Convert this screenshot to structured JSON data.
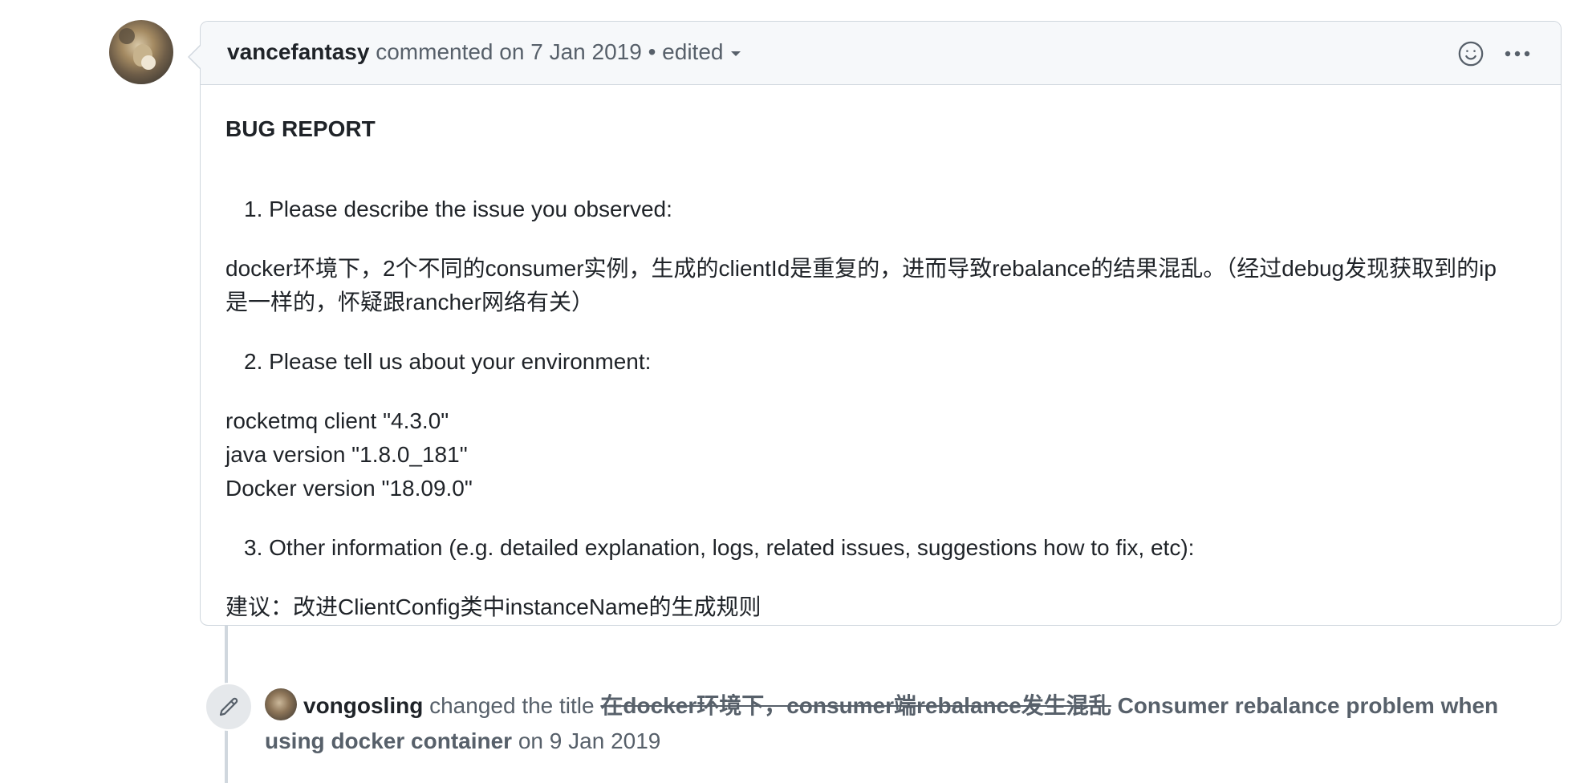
{
  "comment": {
    "author": "vancefantasy",
    "action": "commented on",
    "date": "7 Jan 2019",
    "separator": "•",
    "edited_label": "edited",
    "icons": {
      "reaction": "smiley-icon",
      "menu": "kebab-horizontal-icon"
    },
    "body": {
      "heading": "BUG REPORT",
      "item1": "1. Please describe the issue you observed:",
      "desc_line1": "docker环境下，2个不同的consumer实例，生成的clientId是重复的，进而导致rebalance的结果混乱。（经过debug发现获取到的ip",
      "desc_line2": "是一样的，怀疑跟rancher网络有关）",
      "item2": "2. Please tell us about your environment:",
      "env_line1": "rocketmq client \"4.3.0\"",
      "env_line2": "java version \"1.8.0_181\"",
      "env_line3": "Docker version \"18.09.0\"",
      "item3": "3. Other information (e.g. detailed explanation, logs, related issues, suggestions how to fix, etc):",
      "suggestion": "建议：改进ClientConfig类中instanceName的生成规则"
    }
  },
  "event": {
    "user": "vongosling",
    "action": "changed the title",
    "old_title": "在docker环境下，consumer端rebalance发生混乱",
    "new_title_line1": "Consumer rebalance problem when",
    "new_title_line2": "using docker container",
    "on_label": "on",
    "date": "9 Jan 2019",
    "icon": "pencil-icon"
  },
  "colors": {
    "border": "#d0d7de",
    "header_bg": "#f6f8fa",
    "text": "#1f2328",
    "muted": "#57606a"
  }
}
